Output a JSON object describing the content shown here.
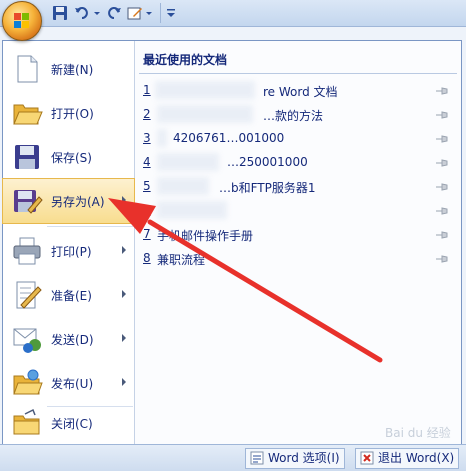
{
  "menu": {
    "items": [
      {
        "label": "新建(N)",
        "icon": "new-document-icon",
        "arrow": false
      },
      {
        "label": "打开(O)",
        "icon": "open-folder-icon",
        "arrow": false
      },
      {
        "label": "保存(S)",
        "icon": "save-disk-icon",
        "arrow": false
      },
      {
        "label": "另存为(A)",
        "icon": "save-as-icon",
        "arrow": true
      },
      {
        "label": "打印(P)",
        "icon": "printer-icon",
        "arrow": true
      },
      {
        "label": "准备(E)",
        "icon": "prepare-icon",
        "arrow": true
      },
      {
        "label": "发送(D)",
        "icon": "send-icon",
        "arrow": true
      },
      {
        "label": "发布(U)",
        "icon": "publish-icon",
        "arrow": true
      },
      {
        "label": "关闭(C)",
        "icon": "close-folder-icon",
        "arrow": false
      }
    ]
  },
  "recent": {
    "title": "最近使用的文档",
    "docs": [
      {
        "num": "1",
        "name": "re Word 文档"
      },
      {
        "num": "2",
        "name": "…款的方法"
      },
      {
        "num": "3",
        "name": "4206761…001000"
      },
      {
        "num": "4",
        "name": "…250001000"
      },
      {
        "num": "5",
        "name": "…b和FTP服务器1"
      },
      {
        "num": "6",
        "name": ""
      },
      {
        "num": "7",
        "name": "手机邮件操作手册"
      },
      {
        "num": "8",
        "name": "兼职流程"
      }
    ]
  },
  "bottom": {
    "options_label": "Word 选项(I)",
    "exit_label": "退出 Word(X)"
  },
  "watermark": "Bai du 经验",
  "colors": {
    "selected": "#f8dd8f",
    "annotation_arrow": "#e8312b",
    "text": "#15297a"
  }
}
